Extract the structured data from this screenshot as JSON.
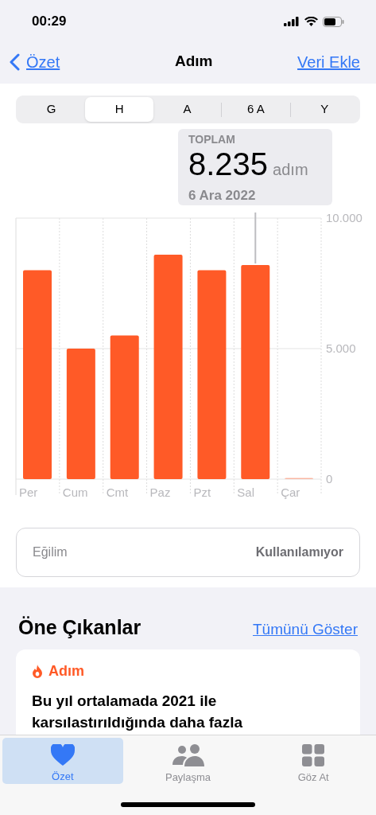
{
  "status_bar": {
    "time": "00:29"
  },
  "nav": {
    "back": "Özet",
    "title": "Adım",
    "action": "Veri Ekle"
  },
  "segments": [
    {
      "label": "G",
      "selected": false
    },
    {
      "label": "H",
      "selected": true
    },
    {
      "label": "A",
      "selected": false
    },
    {
      "label": "6 A",
      "selected": false
    },
    {
      "label": "Y",
      "selected": false
    }
  ],
  "tooltip": {
    "label": "TOPLAM",
    "value": "8.235",
    "unit": "adım",
    "date": "6 Ara 2022"
  },
  "chart": {
    "chart_data": {
      "type": "bar",
      "categories": [
        "Per",
        "Cum",
        "Cmt",
        "Paz",
        "Pzt",
        "Sal",
        "Çar"
      ],
      "series": [
        {
          "color": "#ff5a27",
          "values": [
            8000,
            5000,
            5500,
            8600,
            8000,
            8200,
            0
          ]
        }
      ],
      "ylim": [
        0,
        10000
      ],
      "yticks": [
        0,
        {
          "value": 5000,
          "label": "5.000"
        },
        {
          "value": 10000,
          "label": "10.000"
        }
      ]
    }
  },
  "trend": {
    "label": "Eğilim",
    "value": "Kullanılamıyor"
  },
  "highlights": {
    "title": "Öne Çıkanlar",
    "link": "Tümünü Göster",
    "card": {
      "category": "Adım",
      "text": "Bu yıl ortalamada 2021 ile karsılastırıldığında daha fazla"
    }
  },
  "tab_bar": [
    {
      "label": "Özet",
      "kind": "heart",
      "selected": true
    },
    {
      "label": "Paylaşma",
      "kind": "people",
      "selected": false
    },
    {
      "label": "Göz At",
      "kind": "grid",
      "selected": false
    }
  ]
}
